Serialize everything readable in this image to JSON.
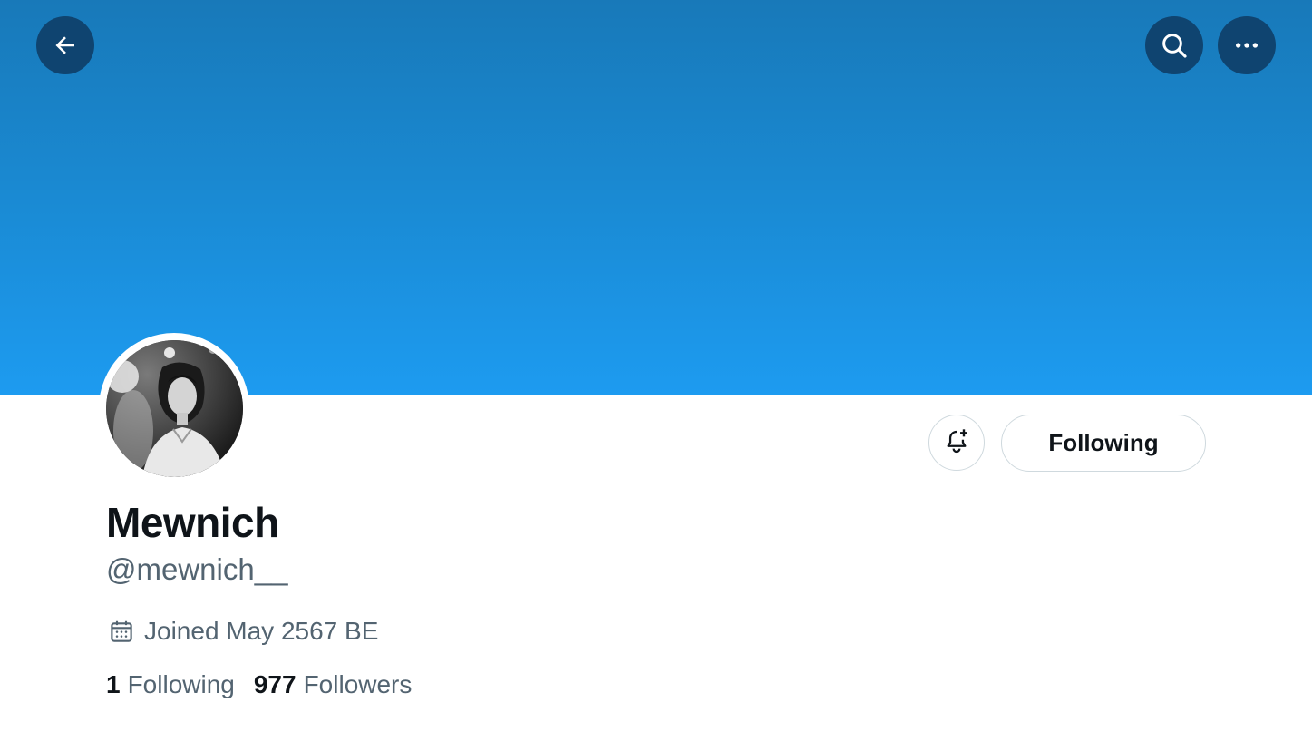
{
  "header": {
    "back_icon": "arrow-left-icon",
    "search_icon": "search-icon",
    "more_icon": "more-horizontal-icon",
    "banner_color": "#1d9bf0",
    "button_bg_color": "#0f4470"
  },
  "profile": {
    "display_name": "Mewnich",
    "handle": "@mewnich__",
    "joined_text": "Joined May 2567 BE",
    "joined_icon": "calendar-icon"
  },
  "actions": {
    "notify_icon": "bell-plus-icon",
    "following_label": "Following"
  },
  "stats": {
    "following_count": "1",
    "following_label": "Following",
    "followers_count": "977",
    "followers_label": "Followers"
  }
}
